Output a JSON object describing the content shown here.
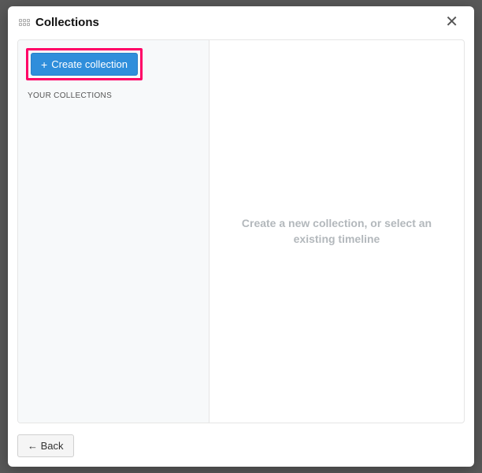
{
  "header": {
    "title": "Collections"
  },
  "sidebar": {
    "create_label": "Create collection",
    "section_label": "YOUR COLLECTIONS"
  },
  "main": {
    "placeholder": "Create a new collection, or select an existing timeline"
  },
  "footer": {
    "back_label": "← Back"
  }
}
